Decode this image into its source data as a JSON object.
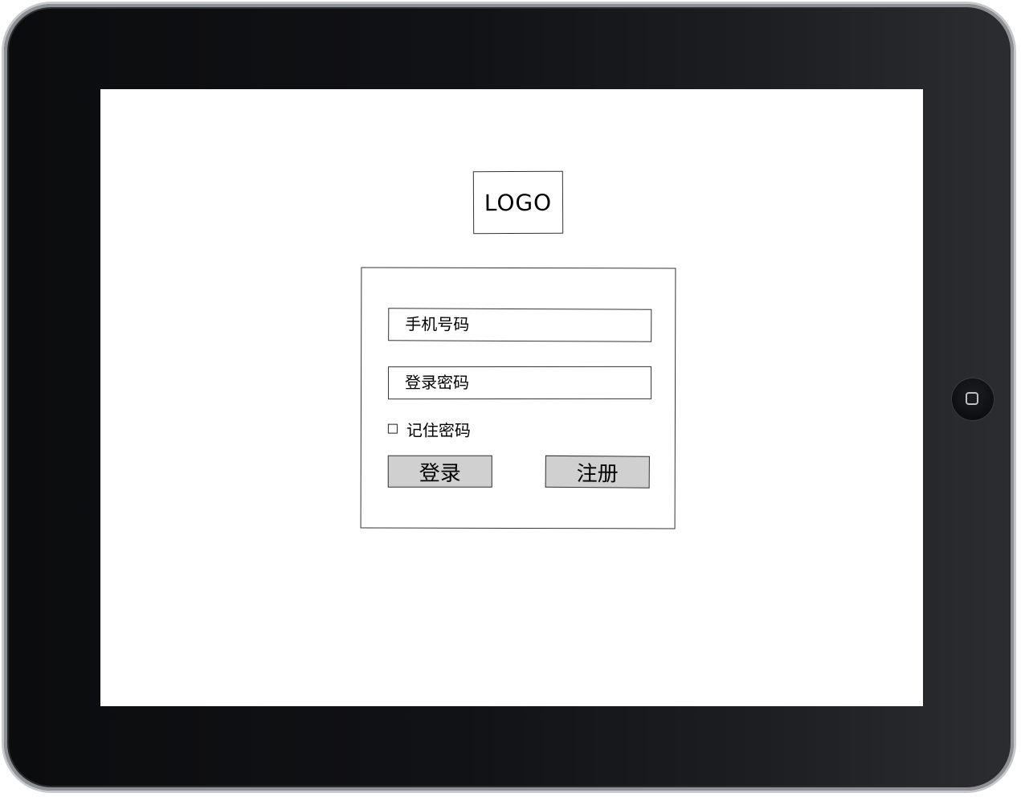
{
  "logo": {
    "text": "LOGO"
  },
  "form": {
    "phone_placeholder": "手机号码",
    "password_placeholder": "登录密码",
    "remember_label": "记住密码",
    "remember_checked": false,
    "login_label": "登录",
    "register_label": "注册"
  },
  "device": {
    "frame_color": "#111215",
    "bezel_color": "#c6c8cb",
    "screen_color": "#ffffff",
    "button_fill": "#d0d0d0"
  }
}
